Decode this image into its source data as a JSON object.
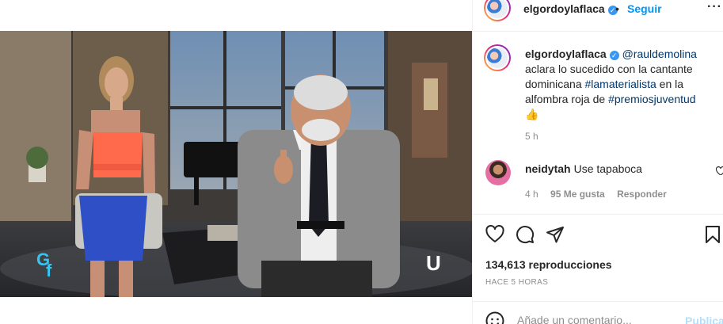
{
  "post": {
    "username": "elgordoylaflaca",
    "verified_mark": "✓",
    "separator": "•",
    "follow_label": "Seguir",
    "more_label": "···"
  },
  "caption": {
    "username": "elgordoylaflaca",
    "mention": "@rauldemolina",
    "text_1": "aclara lo sucedido con la cantante dominicana",
    "hashtag_1": "#lamaterialista",
    "text_2": "en la alfombra roja de",
    "hashtag_2": "#premiosjuventud",
    "emoji": "👍",
    "time": "5 h"
  },
  "comment": {
    "username": "neidytah",
    "text": "Use tapaboca",
    "time": "4 h",
    "likes": "95 Me gusta",
    "reply_label": "Responder"
  },
  "stats": {
    "views": "134,613 reproducciones",
    "posted": "HACE 5 HORAS"
  },
  "composer": {
    "placeholder": "Añade un comentario...",
    "publish_label": "Publicar"
  },
  "icons": {
    "like": "heart-icon",
    "comment": "comment-icon",
    "share": "share-icon",
    "save": "bookmark-icon",
    "emoji": "emoji-icon",
    "more": "more-options-icon"
  },
  "colors": {
    "link": "#00376b",
    "follow": "#0095f6",
    "muted": "#8e8e8e",
    "verified": "#3897f0",
    "publish_disabled": "#b2dffc"
  }
}
